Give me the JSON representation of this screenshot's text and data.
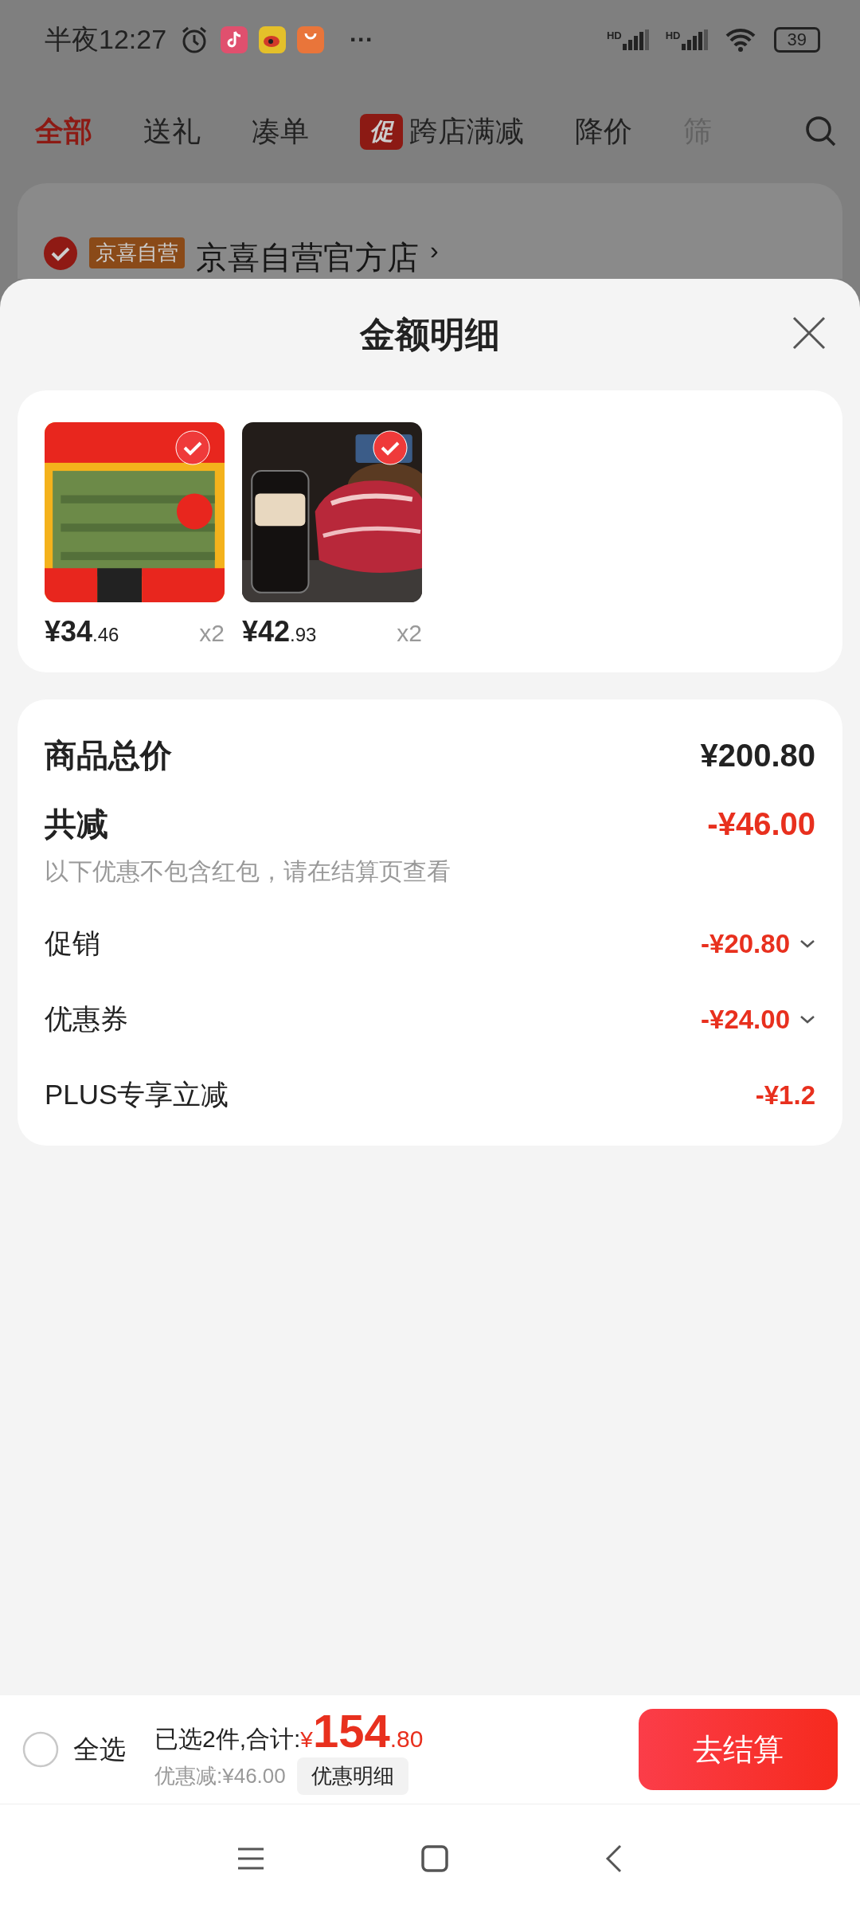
{
  "status_bar": {
    "time": "半夜12:27",
    "more": "···",
    "signal": [
      "HD",
      "HD"
    ],
    "battery": "39"
  },
  "tabs": [
    {
      "label": "全部",
      "selected": true
    },
    {
      "label": "送礼",
      "selected": false
    },
    {
      "label": "凑单",
      "selected": false
    },
    {
      "label": "跨店满减",
      "selected": false,
      "badge": "促"
    },
    {
      "label": "降价",
      "selected": false
    },
    {
      "label": "筛",
      "selected": false,
      "faded": true
    }
  ],
  "store": {
    "checked": true,
    "tag": "京喜自营",
    "name": "京喜自营官方店",
    "chevron": "›"
  },
  "sheet": {
    "title": "金额明细"
  },
  "products": [
    {
      "kind": "tarp",
      "price_int": "¥34",
      "price_dec": ".46",
      "qty": "x2",
      "selected": true
    },
    {
      "kind": "meat",
      "price_int": "¥42",
      "price_dec": ".93",
      "qty": "x2",
      "selected": true
    }
  ],
  "summary": {
    "total_label": "商品总价",
    "total": "¥200.80",
    "reduce_label": "共减",
    "reduce": "-¥46.00",
    "note": "以下优惠不包含红包，请在结算页查看",
    "items": [
      {
        "label": "促销",
        "value": "-¥20.80",
        "expandable": true
      },
      {
        "label": "优惠券",
        "value": "-¥24.00",
        "expandable": true
      },
      {
        "label": "PLUS专享立减",
        "value": "-¥1.2",
        "expandable": false
      }
    ]
  },
  "footer": {
    "select_all": {
      "label": "全选",
      "checked": false
    },
    "selected_text": "已选2件,合计:",
    "currency": "¥",
    "total_int": "154",
    "total_dec": ".80",
    "discount": "优惠减:¥46.00",
    "detail_button": "优惠明细",
    "checkout": "去结算"
  }
}
